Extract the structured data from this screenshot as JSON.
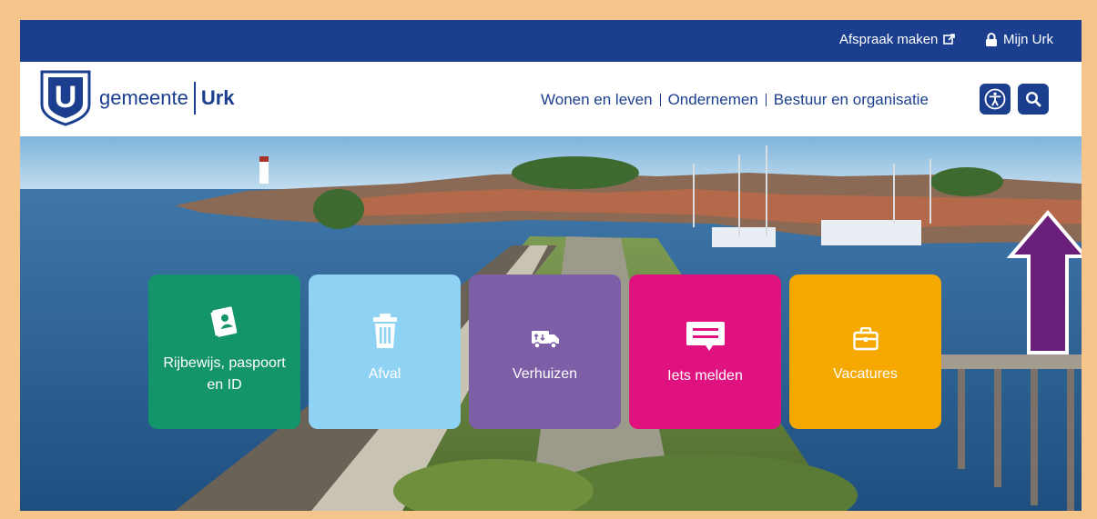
{
  "topbar": {
    "appointment_label": "Afspraak maken",
    "account_label": "Mijn Urk"
  },
  "header": {
    "logo_letter": "U",
    "logo_prefix": "gemeente",
    "logo_name": "Urk",
    "nav": [
      "Wonen en leven",
      "Ondernemen",
      "Bestuur en organisatie"
    ],
    "accessibility_icon": "accessibility-icon",
    "search_icon": "search-icon"
  },
  "tiles": [
    {
      "label": "Rijbewijs, paspoort en ID",
      "color": "#14946a",
      "icon": "id-card-icon"
    },
    {
      "label": "Afval",
      "color": "#8fd3f4",
      "icon": "trash-bin-icon"
    },
    {
      "label": "Verhuizen",
      "color": "#7d5fa8",
      "icon": "moving-truck-icon"
    },
    {
      "label": "Iets melden",
      "color": "#e0127f",
      "icon": "chat-message-icon"
    },
    {
      "label": "Vacatures",
      "color": "#f4a800",
      "icon": "briefcase-icon"
    }
  ],
  "colors": {
    "brand": "#1b3f8e",
    "frame": "#f5c58b",
    "annotation_arrow": "#6a1f7a"
  }
}
